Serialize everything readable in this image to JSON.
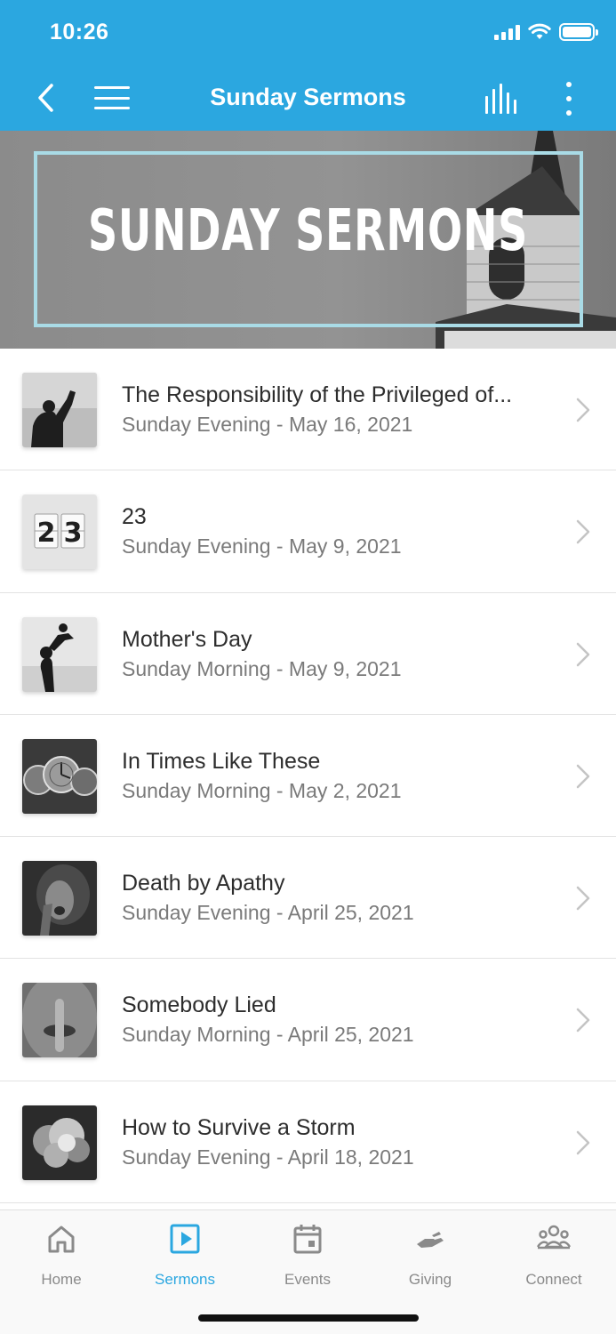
{
  "status_bar": {
    "time": "10:26"
  },
  "header": {
    "title": "Sunday Sermons"
  },
  "banner": {
    "title": "SUNDAY SERMONS"
  },
  "sermons": [
    {
      "title": "The Responsibility of the Privileged of...",
      "subtitle": "Sunday Evening - May 16, 2021",
      "thumb": "silhouette-fist-image"
    },
    {
      "title": "23",
      "subtitle": "Sunday Evening - May 9, 2021",
      "thumb": "number-23-image"
    },
    {
      "title": "Mother's Day",
      "subtitle": "Sunday Morning - May 9, 2021",
      "thumb": "mother-child-image"
    },
    {
      "title": "In Times Like These",
      "subtitle": "Sunday Morning - May 2, 2021",
      "thumb": "pocket-watches-image"
    },
    {
      "title": "Death by Apathy",
      "subtitle": "Sunday Evening - April 25, 2021",
      "thumb": "distressed-woman-image"
    },
    {
      "title": "Somebody Lied",
      "subtitle": "Sunday Morning - April 25, 2021",
      "thumb": "finger-on-lips-image"
    },
    {
      "title": "How to Survive a Storm",
      "subtitle": "Sunday Evening - April 18, 2021",
      "thumb": "storm-clouds-image"
    }
  ],
  "thumb_23": {
    "left": "2",
    "right": "3"
  },
  "tabs": [
    {
      "label": "Home",
      "icon": "home-icon",
      "active": false
    },
    {
      "label": "Sermons",
      "icon": "play-icon",
      "active": true
    },
    {
      "label": "Events",
      "icon": "calendar-icon",
      "active": false
    },
    {
      "label": "Giving",
      "icon": "giving-hand-icon",
      "active": false
    },
    {
      "label": "Connect",
      "icon": "people-icon",
      "active": false
    }
  ],
  "colors": {
    "accent": "#2ba7e0",
    "banner_frame": "#a9dbe6",
    "tab_inactive": "#8a8a8a"
  }
}
